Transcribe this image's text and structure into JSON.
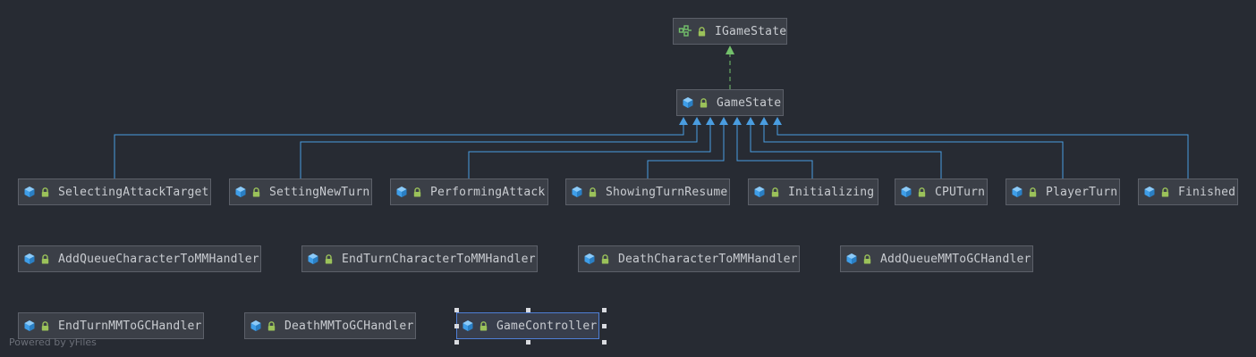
{
  "diagram": {
    "interface": {
      "id": "igamestate",
      "label": "IGameState",
      "icon": "interface-icon"
    },
    "base": {
      "id": "gamestate",
      "label": "GameState",
      "icon": "class-icon"
    },
    "subclasses": [
      {
        "id": "selectingattacktarget",
        "label": "SelectingAttackTarget"
      },
      {
        "id": "settingnewturn",
        "label": "SettingNewTurn"
      },
      {
        "id": "performingattack",
        "label": "PerformingAttack"
      },
      {
        "id": "showingturnresume",
        "label": "ShowingTurnResume"
      },
      {
        "id": "initializing",
        "label": "Initializing"
      },
      {
        "id": "cputurn",
        "label": "CPUTurn"
      },
      {
        "id": "playerturn",
        "label": "PlayerTurn"
      },
      {
        "id": "finished",
        "label": "Finished"
      }
    ],
    "row2": [
      {
        "id": "addqueuecharactertommhandler",
        "label": "AddQueueCharacterToMMHandler"
      },
      {
        "id": "endturncharactertommhandler",
        "label": "EndTurnCharacterToMMHandler"
      },
      {
        "id": "deathcharactertommhandler",
        "label": "DeathCharacterToMMHandler"
      },
      {
        "id": "addqueuemmtogchandler",
        "label": "AddQueueMMToGCHandler"
      }
    ],
    "row3": [
      {
        "id": "endturnmmtogchandler",
        "label": "EndTurnMMToGCHandler"
      },
      {
        "id": "deathmmtogchandler",
        "label": "DeathMMToGCHandler"
      },
      {
        "id": "gamecontroller",
        "label": "GameController",
        "selected": true
      }
    ]
  },
  "watermark": "Powered by yFiles",
  "colors": {
    "background": "#272b33",
    "node_fill": "#3b3f47",
    "node_border": "#5c6069",
    "selected_border": "#4f7fd6",
    "inheritance_edge": "#4a9de0",
    "realization_edge": "#73c06b",
    "class_icon": "#3f9ee8",
    "lock_icon": "#9bc25a"
  }
}
